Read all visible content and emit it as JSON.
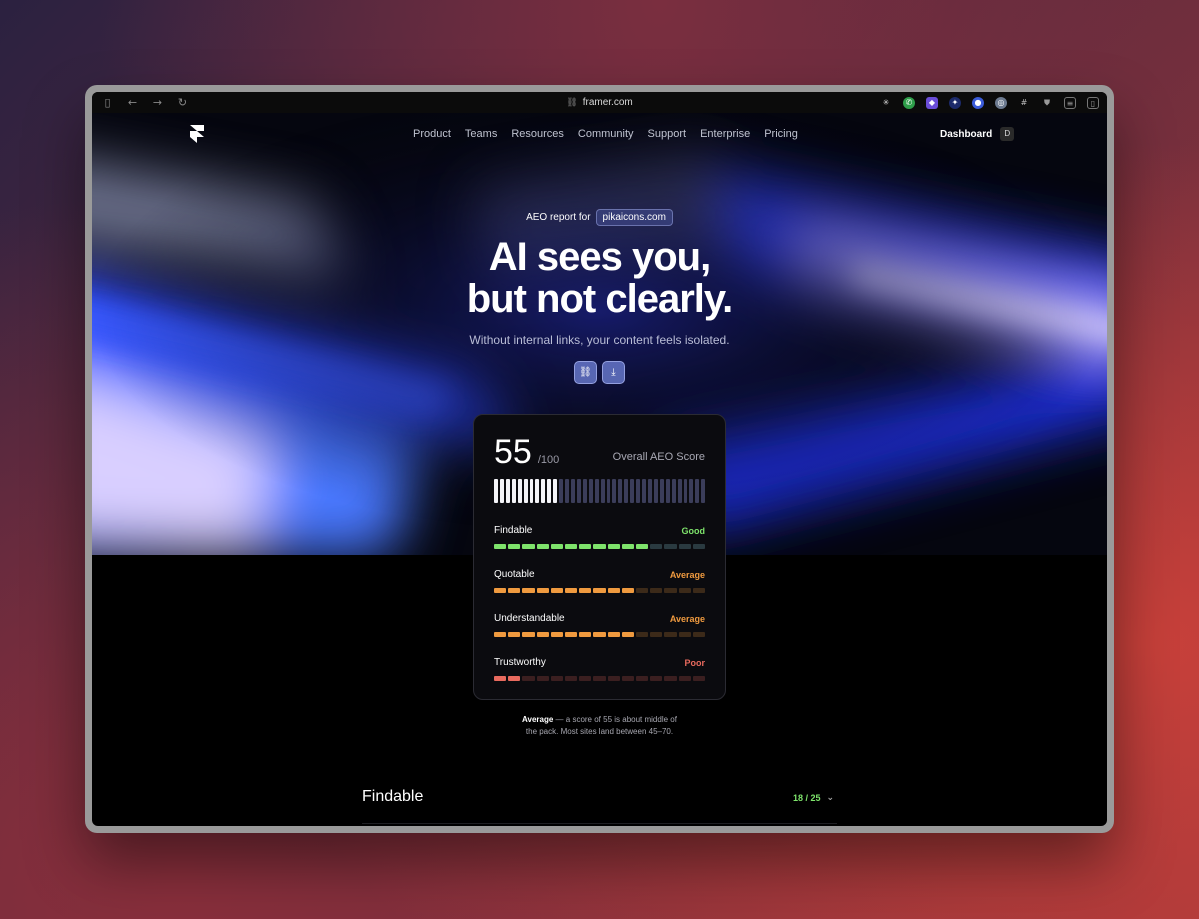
{
  "browser": {
    "url": "framer.com",
    "left_icons": [
      "sidebar-icon",
      "back-icon",
      "forward-icon",
      "reload-icon"
    ],
    "right_icons": [
      "asterisk-icon",
      "whatsapp-icon",
      "figma-icon",
      "spark-icon",
      "globe-icon",
      "chrome-icon",
      "hash-icon",
      "shield-icon",
      "reader-icon",
      "split-view-icon"
    ]
  },
  "nav": {
    "menu": [
      "Product",
      "Teams",
      "Resources",
      "Community",
      "Support",
      "Enterprise",
      "Pricing"
    ],
    "dashboard_label": "Dashboard",
    "avatar_letter": "D"
  },
  "hero": {
    "report_prefix": "AEO report for",
    "report_domain": "pikaicons.com",
    "headline_line1": "AI sees you,",
    "headline_line2": "but not clearly.",
    "subtitle": "Without internal links, your content feels isolated."
  },
  "score_card": {
    "score": "55",
    "score_max": "/100",
    "score_label": "Overall AEO Score",
    "score_fraction": 0.55,
    "metrics": [
      {
        "name": "Findable",
        "status": "Good",
        "color": "#7ee36b",
        "filled": 11,
        "total": 15
      },
      {
        "name": "Quotable",
        "status": "Average",
        "color": "#ef9a3f",
        "filled": 10,
        "total": 15
      },
      {
        "name": "Understandable",
        "status": "Average",
        "color": "#ef9a3f",
        "filled": 10,
        "total": 15
      },
      {
        "name": "Trustworthy",
        "status": "Poor",
        "color": "#e86a5e",
        "filled": 2,
        "total": 15
      }
    ]
  },
  "note": {
    "bold": "Average",
    "line1_rest": " — a score of 55 is about middle of",
    "line2": "the pack. Most sites land between 45–70."
  },
  "section": {
    "title": "Findable",
    "score": "18 / 25"
  }
}
